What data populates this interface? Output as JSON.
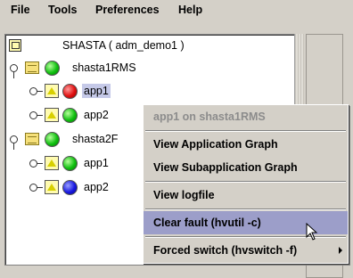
{
  "menubar": {
    "items": [
      "File",
      "Tools",
      "Preferences",
      "Help"
    ]
  },
  "tree": {
    "root_label": "SHASTA ( adm_demo1 )",
    "nodes": [
      {
        "label": "shasta1RMS",
        "status": "green"
      },
      {
        "label": "app1",
        "status": "red"
      },
      {
        "label": "app2",
        "status": "green"
      },
      {
        "label": "shasta2RMS",
        "visible_label": "shasta2F",
        "status": "green"
      },
      {
        "label": "app1",
        "status": "green"
      },
      {
        "label": "app2",
        "status": "blue"
      }
    ]
  },
  "context_menu": {
    "title": "app1 on shasta1RMS",
    "items": [
      "View Application Graph",
      "View Subapplication Graph",
      "View logfile",
      "Clear fault (hvutil -c)",
      "Forced switch (hvswitch -f)"
    ]
  },
  "colors": {
    "menu_highlight": "#9c9ec9",
    "selection": "#c5c9e8",
    "disabled_text": "#8c8c8c"
  }
}
